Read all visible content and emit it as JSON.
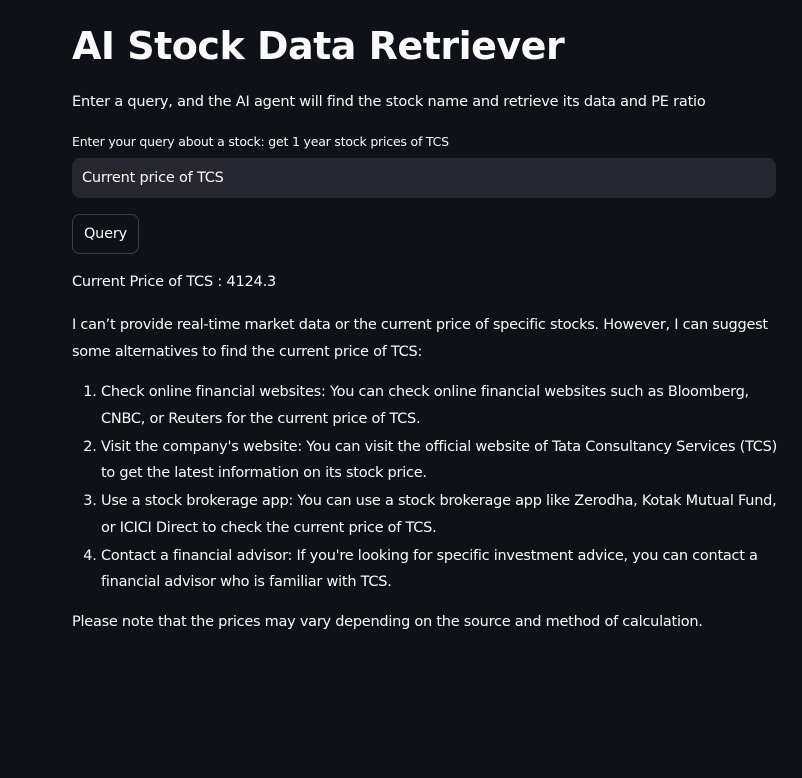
{
  "header": {
    "title": "AI Stock Data Retriever",
    "subtitle": "Enter a query, and the AI agent will find the stock name and retrieve its data and PE ratio"
  },
  "query_form": {
    "label": "Enter your query about a stock: get 1 year stock prices of TCS",
    "input_value": "Current price of TCS",
    "button_label": "Query"
  },
  "result": {
    "price_line": "Current Price of TCS : 4124.3",
    "intro": "I can’t provide real-time market data or the current price of specific stocks. However, I can suggest some alternatives to find the current price of TCS:",
    "steps": [
      "Check online financial websites: You can check online financial websites such as Bloomberg, CNBC, or Reuters for the current price of TCS.",
      "Visit the company's website: You can visit the official website of Tata Consultancy Services (TCS) to get the latest information on its stock price.",
      "Use a stock brokerage app: You can use a stock brokerage app like Zerodha, Kotak Mutual Fund, or ICICI Direct to check the current price of TCS.",
      "Contact a financial advisor: If you're looking for specific investment advice, you can contact a financial advisor who is familiar with TCS."
    ],
    "note": "Please note that the prices may vary depending on the source and method of calculation."
  },
  "colors": {
    "background": "#0e1117",
    "text": "#fafafa",
    "input_background": "#262730",
    "button_border": "rgba(250,250,250,0.2)"
  }
}
